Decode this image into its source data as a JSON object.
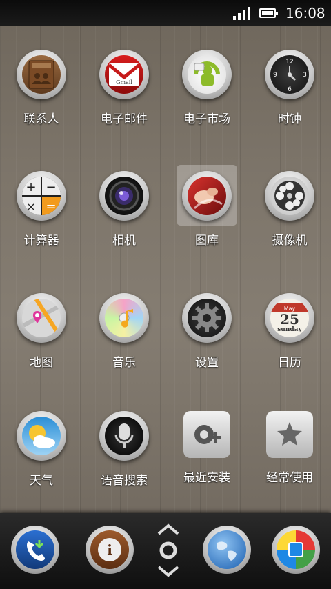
{
  "status": {
    "time": "16:08",
    "signal_icon": "signal-bars-icon",
    "battery_icon": "battery-icon"
  },
  "apps": [
    {
      "label": "联系人",
      "icon": "contacts-icon"
    },
    {
      "label": "电子邮件",
      "icon": "gmail-icon",
      "icon_text": "Gmail"
    },
    {
      "label": "电子市场",
      "icon": "market-icon"
    },
    {
      "label": "时钟",
      "icon": "clock-icon",
      "clock_numbers": [
        "12",
        "3",
        "6",
        "9"
      ]
    },
    {
      "label": "计算器",
      "icon": "calculator-icon"
    },
    {
      "label": "相机",
      "icon": "camera-icon"
    },
    {
      "label": "图库",
      "icon": "gallery-icon"
    },
    {
      "label": "摄像机",
      "icon": "video-camera-icon"
    },
    {
      "label": "地图",
      "icon": "map-icon"
    },
    {
      "label": "音乐",
      "icon": "music-icon"
    },
    {
      "label": "设置",
      "icon": "gear-icon"
    },
    {
      "label": "日历",
      "icon": "calendar-icon",
      "month": "May",
      "day": "25",
      "weekday": "sunday"
    },
    {
      "label": "天气",
      "icon": "weather-icon"
    },
    {
      "label": "语音搜索",
      "icon": "microphone-icon"
    },
    {
      "label": "最近安装",
      "icon": "recent-install-icon"
    },
    {
      "label": "经常使用",
      "icon": "star-icon"
    }
  ],
  "dock": [
    {
      "name": "phone-icon"
    },
    {
      "name": "messaging-icon",
      "text": "i"
    },
    {
      "name": "app-drawer-icon"
    },
    {
      "name": "browser-globe-icon"
    },
    {
      "name": "colorful-app-icon"
    }
  ]
}
